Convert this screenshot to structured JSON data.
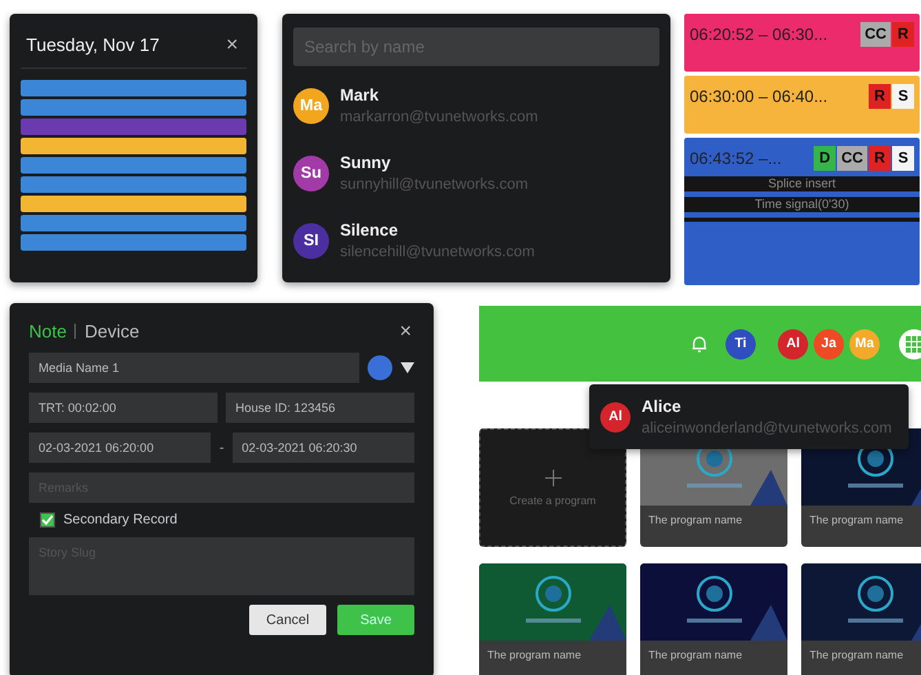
{
  "calendar": {
    "title": "Tuesday, Nov 17",
    "close": "×",
    "events": [
      {
        "color": "#3b86d6"
      },
      {
        "color": "#3b86d6"
      },
      {
        "color": "#6b3aae"
      },
      {
        "color": "#f3b632"
      },
      {
        "color": "#3b86d6"
      },
      {
        "color": "#3b86d6"
      },
      {
        "color": "#f3b632"
      },
      {
        "color": "#3b86d6"
      },
      {
        "color": "#3b86d6"
      }
    ]
  },
  "people": {
    "search": {
      "placeholder": "Search by name"
    },
    "users": [
      {
        "initials": "Ma",
        "name": "Mark",
        "email": "markarron@tvunetworks.com",
        "color": "#f2a51e"
      },
      {
        "initials": "Su",
        "name": "Sunny",
        "email": "sunnyhill@tvunetworks.com",
        "color": "#a23ba8"
      },
      {
        "initials": "SI",
        "name": "Silence",
        "email": "silencehill@tvunetworks.com",
        "color": "#4b2fa0"
      }
    ]
  },
  "schedule": [
    {
      "time": "06:20:52 – 06:30...",
      "color": "#ec2b6c",
      "badges": [
        {
          "kind": "cc",
          "label": "CC"
        },
        {
          "kind": "r",
          "label": "R"
        }
      ]
    },
    {
      "time": "06:30:00 – 06:40...",
      "color": "#f6b43c",
      "badges": [
        {
          "kind": "r",
          "label": "R"
        },
        {
          "kind": "s",
          "label": "S"
        }
      ]
    },
    {
      "time": "06:43:52 –...",
      "color": "#2f5fc6",
      "badges": [
        {
          "kind": "d",
          "label": "D"
        },
        {
          "kind": "cc",
          "label": "CC"
        },
        {
          "kind": "r",
          "label": "R"
        },
        {
          "kind": "s",
          "label": "S"
        }
      ],
      "markers": [
        {
          "kind": "labeled",
          "label": "Splice insert"
        },
        {
          "kind": "labeled",
          "label": "Time signal(0'30)"
        },
        {
          "kind": "blank"
        }
      ]
    }
  ],
  "form": {
    "tabs": [
      {
        "label": "Note",
        "selected": true
      },
      {
        "label": "Device",
        "selected": false
      }
    ],
    "close": "×",
    "media_name": "Media Name 1",
    "color": "#3a6fd8",
    "trt": "TRT: 00:02:00",
    "house_id": "House ID: 123456",
    "start": "02-03-2021 06:20:00",
    "separator": "-",
    "end": "02-03-2021 06:20:30",
    "remarks": {
      "placeholder": "Remarks"
    },
    "secondary": {
      "label": "Secondary Record",
      "checked": true
    },
    "story": {
      "placeholder": "Story Slug"
    },
    "buttons": [
      {
        "label": "Cancel",
        "kind": "secondary"
      },
      {
        "label": "Save",
        "kind": "primary"
      }
    ]
  },
  "header": {
    "avatars": [
      {
        "initials": "Ti",
        "color": "#2f4fc0"
      },
      {
        "initials": "Al",
        "color": "#d4252c"
      },
      {
        "initials": "Ja",
        "color": "#ee4a24"
      },
      {
        "initials": "Ma",
        "color": "#f3a92a"
      }
    ],
    "popup": {
      "initials": "Al",
      "name": "Alice",
      "email": "aliceinwonderland@tvunetworks.com",
      "color": "#d4252c"
    }
  },
  "programs": [
    {
      "kind": "create",
      "label": "Create a program"
    },
    {
      "kind": "program",
      "name": "The program name"
    },
    {
      "kind": "program",
      "name": "The program name"
    },
    {
      "kind": "program",
      "name": "The program name"
    },
    {
      "kind": "program",
      "name": "The program name"
    },
    {
      "kind": "program",
      "name": "The program name"
    }
  ]
}
